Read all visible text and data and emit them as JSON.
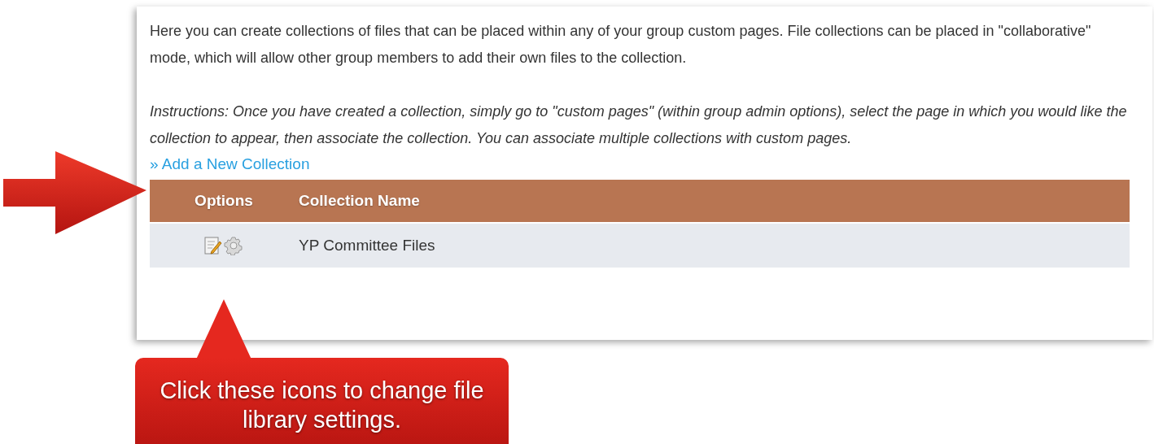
{
  "intro": "Here you can create collections of files that can be placed within any of your group custom pages. File collections can be placed in \"collaborative\" mode, which will allow other group members to add their own files to the collection.",
  "instructions": "Instructions: Once you have created a collection, simply go to \"custom pages\" (within group admin options), select the page in which you would like the collection to appear, then associate the collection. You can associate multiple collections with custom pages.",
  "add_link": "» Add a New Collection",
  "table": {
    "columns": [
      "Options",
      "Collection Name"
    ],
    "rows": [
      {
        "collection_name": "YP Committee Files"
      }
    ]
  },
  "callout": "Click these icons to change file library settings."
}
